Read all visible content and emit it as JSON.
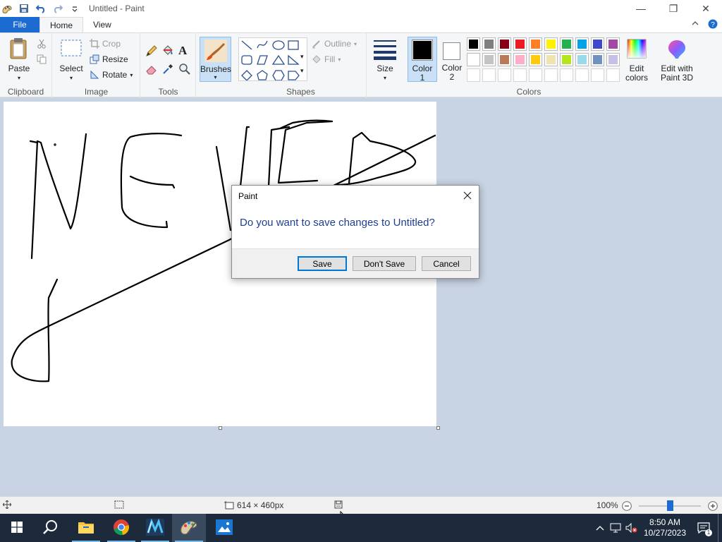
{
  "window": {
    "title": "Untitled - Paint",
    "controls": {
      "minimize": "—",
      "restore": "❐",
      "close": "✕"
    }
  },
  "tabs": [
    {
      "label": "File"
    },
    {
      "label": "Home"
    },
    {
      "label": "View"
    }
  ],
  "ribbon": {
    "clipboard": {
      "label": "Clipboard",
      "paste": "Paste"
    },
    "image": {
      "label": "Image",
      "select": "Select",
      "crop": "Crop",
      "resize": "Resize",
      "rotate": "Rotate"
    },
    "tools": {
      "label": "Tools"
    },
    "brushes": {
      "label": "Brushes"
    },
    "shapes": {
      "label": "Shapes",
      "outline": "Outline",
      "fill": "Fill"
    },
    "size": {
      "label": "Size"
    },
    "color1": {
      "label_line1": "Color",
      "label_line2": "1",
      "value": "#000000"
    },
    "color2": {
      "label_line1": "Color",
      "label_line2": "2",
      "value": "#ffffff"
    },
    "colors": {
      "label": "Colors",
      "row1": [
        "#000000",
        "#7f7f7f",
        "#880015",
        "#ed1c24",
        "#ff7f27",
        "#fff200",
        "#22b14c",
        "#00a2e8",
        "#3f48cc",
        "#a349a4"
      ],
      "row2": [
        "#ffffff",
        "#c3c3c3",
        "#b97a57",
        "#ffaec9",
        "#ffc90e",
        "#efe4b0",
        "#b5e61d",
        "#99d9ea",
        "#7092be",
        "#c8bfe7"
      ]
    },
    "edit_colors": {
      "line1": "Edit",
      "line2": "colors"
    },
    "paint3d": {
      "line1": "Edit with",
      "line2": "Paint 3D"
    }
  },
  "status": {
    "canvas_size": "614 × 460px",
    "zoom": "100%",
    "zoom_level": 0.5
  },
  "dialog": {
    "title": "Paint",
    "message": "Do you want to save changes to Untitled?",
    "save": "Save",
    "dont_save": "Don't Save",
    "cancel": "Cancel"
  },
  "taskbar": {
    "time": "8:50 AM",
    "date": "10/27/2023"
  }
}
